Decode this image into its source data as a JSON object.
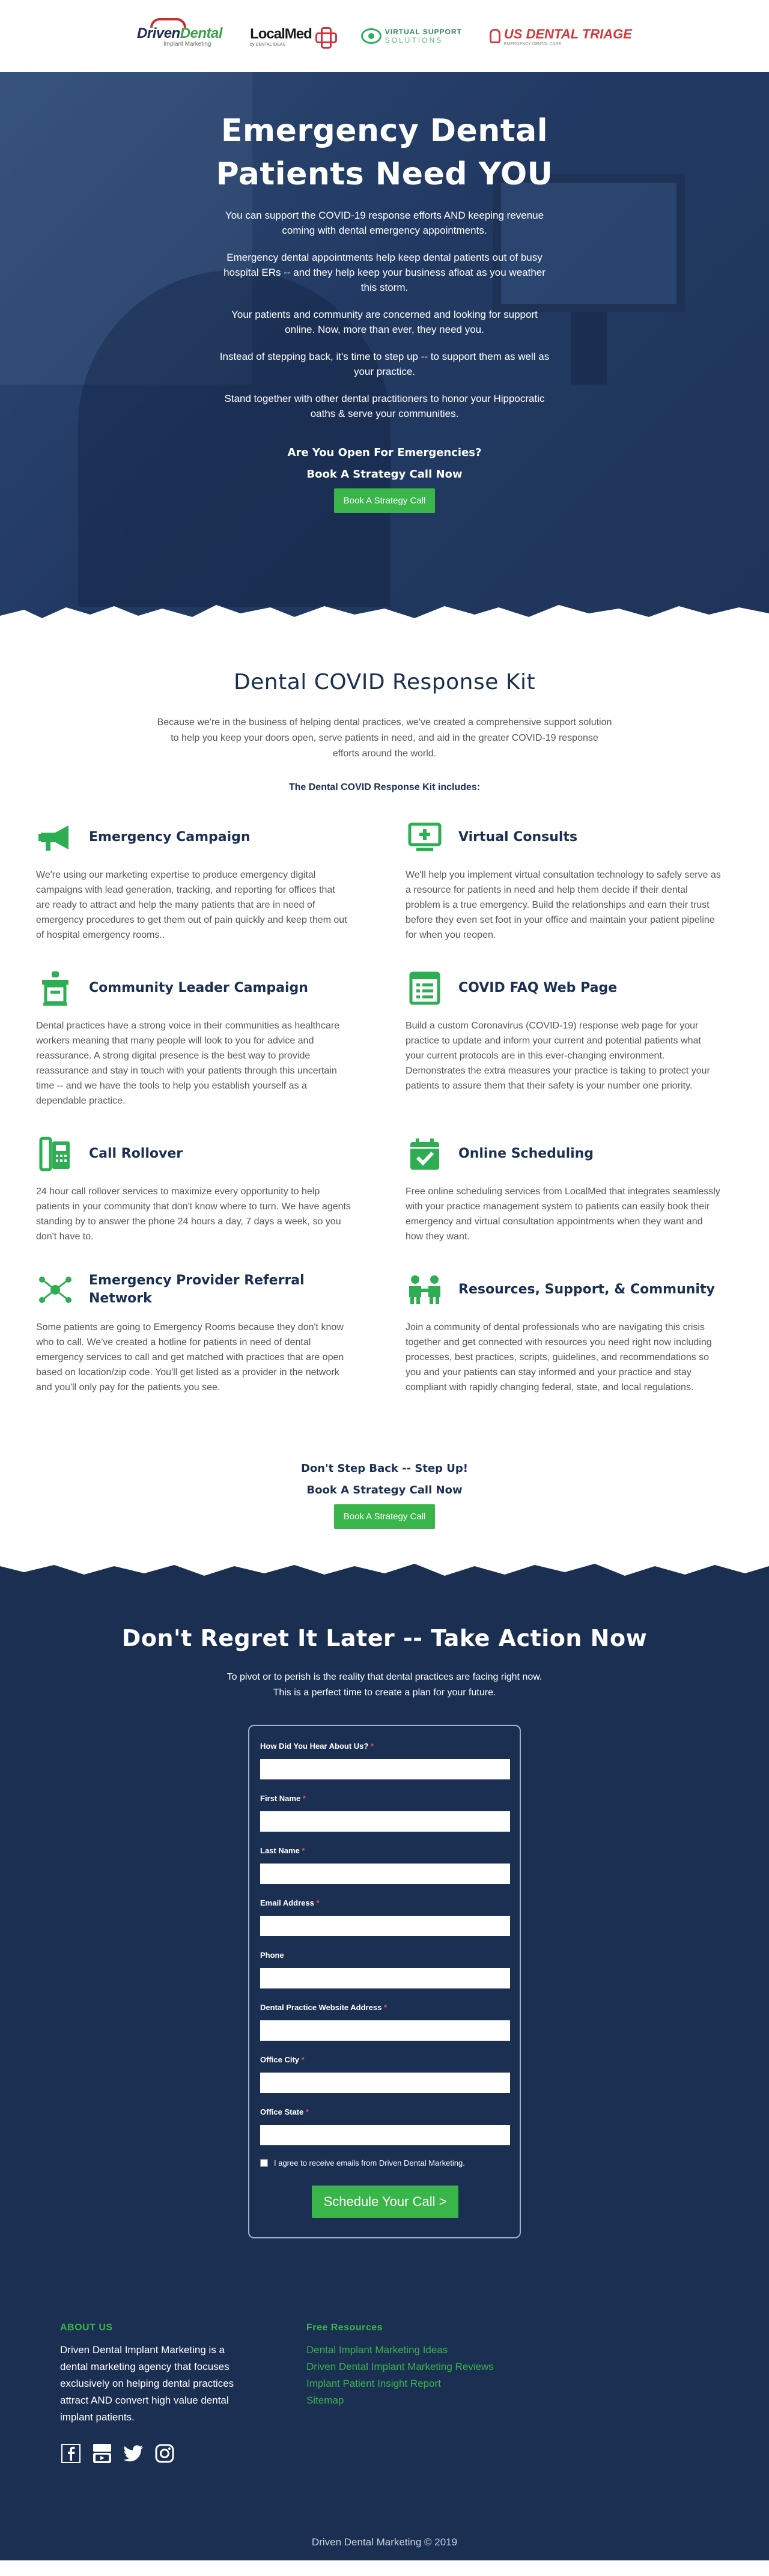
{
  "logos": {
    "driven": {
      "word_a": "Driven",
      "word_b": "Dental",
      "sub": "Implant Marketing"
    },
    "localmed": {
      "word": "LocalMed",
      "sub": "by DENTAL IDEAS"
    },
    "vss": {
      "line1": "VIRTUAL SUPPORT",
      "line2": "SOLUTIONS"
    },
    "triage": {
      "word": "US DENTAL TRIAGE",
      "sub": "EMERGENCY DENTAL CARE"
    }
  },
  "hero": {
    "title": "Emergency Dental Patients Need YOU",
    "paragraphs": [
      "You can support the COVID-19 response efforts AND keeping revenue coming with dental emergency appointments.",
      "Emergency dental appointments help keep dental patients out of busy hospital ERs -- and they help keep your business afloat as you weather this storm.",
      "Your patients and community are concerned and looking for support online. Now, more than ever, they need you.",
      "Instead of stepping back, it's time to step up -- to support them as well as your practice.",
      "Stand together with other dental practitioners to honor your Hippocratic oaths & serve your communities."
    ],
    "cta_question": "Are You Open For Emergencies?",
    "cta_heading": "Book A Strategy Call Now",
    "button": "Book A Strategy Call"
  },
  "kit": {
    "title": "Dental COVID Response Kit",
    "intro": "Because we're in the business of helping dental practices, we've created a comprehensive support solution to help you keep your doors open, serve patients in need, and aid in the greater COVID-19 response efforts around the world.",
    "includes": "The Dental COVID Response Kit includes:",
    "features": [
      {
        "title": "Emergency Campaign",
        "icon": "megaphone-icon",
        "body": "We're using our marketing expertise to produce emergency digital campaigns with lead generation, tracking, and reporting for offices that are ready to attract and help the many patients that are in need of emergency procedures to get them out of pain quickly and keep them out of hospital emergency rooms.."
      },
      {
        "title": "Virtual Consults",
        "icon": "monitor-plus-icon",
        "body": "We'll help you implement virtual consultation technology to safely serve as a resource for patients in need and help them decide if their dental problem is a true emergency. Build the relationships and earn their trust before they even set foot in your office and maintain your patient pipeline for when you reopen."
      },
      {
        "title": "Community Leader Campaign",
        "icon": "podium-icon",
        "body": "Dental practices have a strong voice in their communities as healthcare workers meaning that many people will look to you for advice and reassurance. A strong digital presence is the best way to provide reassurance and stay in touch with your patients through this uncertain time -- and we have the tools to help you establish yourself as a dependable practice."
      },
      {
        "title": "COVID FAQ Web Page",
        "icon": "web-page-icon",
        "body": "Build a custom Coronavirus (COVID-19) response web page for your practice to update and inform your current and potential patients what your current protocols are in this ever-changing environment. Demonstrates the extra measures your practice is taking to protect your patients to assure them that their safety is your number one priority."
      },
      {
        "title": "Call Rollover",
        "icon": "phone-icon",
        "body": "24 hour call rollover services to maximize every opportunity to help patients in your community that don't know where to turn. We have agents standing by to answer the phone 24 hours a day, 7 days a week, so you don't have to."
      },
      {
        "title": "Online Scheduling",
        "icon": "calendar-check-icon",
        "body": "Free online scheduling services from LocalMed that integrates seamlessly with your practice management system to patients can easily book their emergency and virtual consultation appointments when they want and how they want."
      },
      {
        "title": "Emergency Provider Referral Network",
        "icon": "network-icon",
        "body": "Some patients are going to Emergency Rooms because they don't know who to call. We've created a hotline for patients in need of dental emergency services to call and get matched with practices that are open based on location/zip code. You'll get listed as a provider in the network and you'll only pay for the patients you see."
      },
      {
        "title": "Resources, Support, & Community",
        "icon": "community-icon",
        "body": "Join a community of dental professionals who are navigating this crisis together and get connected with resources you need right now including processes, best practices, scripts, guidelines, and recommendations so you and your patients can stay informed and your practice and stay compliant with rapidly changing federal, state, and local regulations."
      }
    ]
  },
  "cta_mid": {
    "line1": "Don't Step Back -- Step Up!",
    "line2": "Book A Strategy Call Now",
    "button": "Book A Strategy Call"
  },
  "action": {
    "title": "Don't Regret It Later -- Take Action Now",
    "lead": "To pivot or to perish is the reality that dental practices are facing right now. This is a perfect time to create a plan for your future."
  },
  "form": {
    "fields": [
      {
        "label": "How Did You Hear About Us?",
        "required": "*",
        "value": ""
      },
      {
        "label": "First Name",
        "required": "*",
        "value": ""
      },
      {
        "label": "Last Name",
        "required": "*",
        "value": ""
      },
      {
        "label": "Email Address",
        "required": "*",
        "value": ""
      },
      {
        "label": "Phone",
        "required": "",
        "value": ""
      },
      {
        "label": "Dental Practice Website Address",
        "required": "*",
        "value": ""
      },
      {
        "label": "Office City",
        "required": "*",
        "value": ""
      },
      {
        "label": "Office State",
        "required": "*",
        "value": ""
      }
    ],
    "consent": "I agree to receive emails from Driven Dental Marketing.",
    "submit": "Schedule Your Call >"
  },
  "footer": {
    "about_title": "ABOUT US",
    "about_text": "Driven Dental Implant Marketing is a dental marketing agency that focuses exclusively on helping dental practices attract AND convert high value dental implant patients.",
    "resources_title": "Free Resources",
    "links": [
      "Dental Implant Marketing Ideas",
      "Driven Dental Implant Marketing Reviews",
      "Implant Patient Insight Report",
      "Sitemap"
    ],
    "socials": [
      "facebook-icon",
      "youtube-icon",
      "twitter-icon",
      "instagram-icon"
    ],
    "copyright": "Driven Dental Marketing © 2019"
  },
  "colors": {
    "navy": "#1b2f52",
    "green": "#39b54a",
    "icon_green": "#2eae52",
    "red": "#cf2a27"
  }
}
